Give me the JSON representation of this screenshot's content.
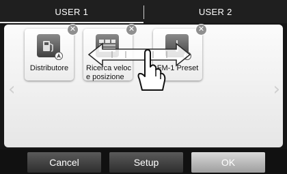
{
  "tabs": [
    {
      "label": "USER 1"
    },
    {
      "label": "USER 2"
    }
  ],
  "tiles": [
    {
      "label": "Distributore",
      "icon": "fuel-station-icon"
    },
    {
      "label": "Ricerca veloc\ne posizione",
      "icon": "quick-search-icon"
    },
    {
      "label": "FM-1 Preset",
      "icon": "radio-preset-icon"
    }
  ],
  "buttons": {
    "cancel_label": "Cancel",
    "setup_label": "Setup",
    "ok_label": "OK"
  },
  "colors": {
    "button_dark": "#3f3f3f",
    "button_light": "#bdbdbd",
    "close_badge": "#8f8f8f"
  }
}
